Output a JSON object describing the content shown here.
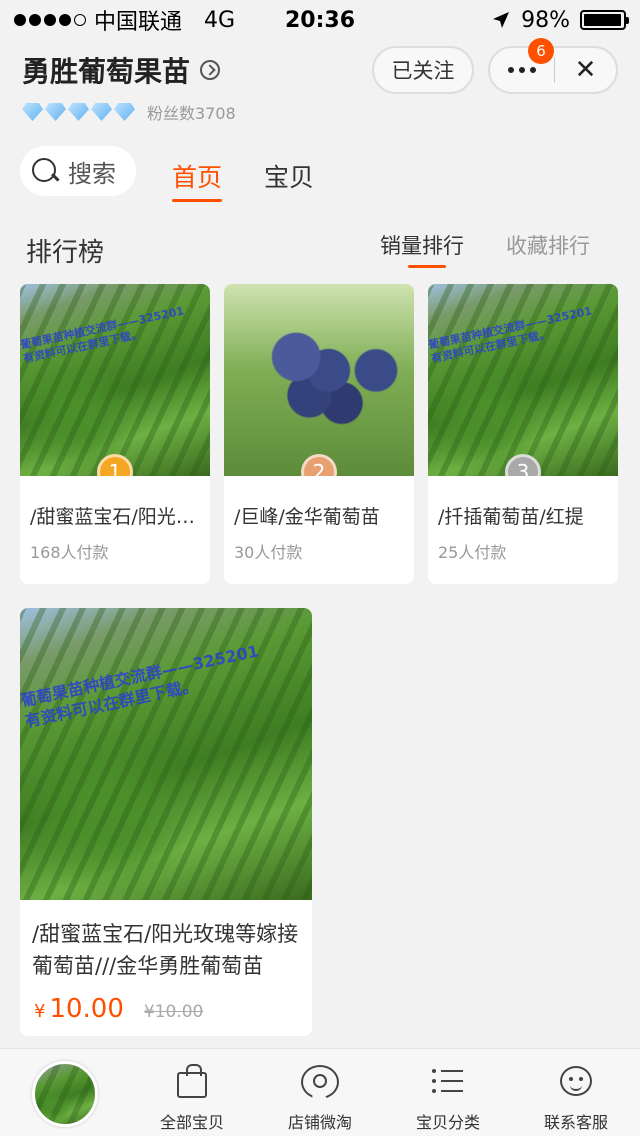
{
  "status_bar": {
    "carrier": "中国联通",
    "network": "4G",
    "time": "20:36",
    "battery": "98%",
    "battery_level": 0.98,
    "signal_dots_filled": 4,
    "signal_dots_total": 5
  },
  "shop": {
    "name": "勇胜葡萄果苗",
    "fans": "粉丝数3708",
    "diamond_count": 5,
    "follow_label": "已关注",
    "notification_count": "6"
  },
  "search": {
    "label": "搜索"
  },
  "tabs": [
    {
      "label": "首页",
      "active": true
    },
    {
      "label": "宝贝",
      "active": false
    }
  ],
  "ranking": {
    "title": "排行榜",
    "tabs": [
      {
        "label": "销量排行",
        "active": true
      },
      {
        "label": "收藏排行",
        "active": false
      }
    ],
    "items": [
      {
        "rank": "1",
        "title": "/甜蜜蓝宝石/阳光玫瑰等嫁接葡萄苗",
        "sold": "168人付款",
        "image": "grape-vine-photo"
      },
      {
        "rank": "2",
        "title": "/巨峰/金华葡萄苗",
        "sold": "30人付款",
        "image": "grape-bunch-photo"
      },
      {
        "rank": "3",
        "title": "/扦插葡萄苗/红提",
        "sold": "25人付款",
        "image": "grape-vine-photo"
      }
    ]
  },
  "watermark": {
    "line1": "葡萄果苗种植交流群——325201",
    "line2": "有资料可以在群里下载。"
  },
  "featured": {
    "title": "/甜蜜蓝宝石/阳光玫瑰等嫁接葡萄苗///金华勇胜葡萄苗",
    "currency": "¥",
    "price": "10.00",
    "original_price": "¥10.00",
    "image": "grape-vine-photo"
  },
  "bottom_nav": [
    {
      "label": "全部宝贝",
      "icon": "bag-icon"
    },
    {
      "label": "店铺微淘",
      "icon": "broadcast-icon"
    },
    {
      "label": "宝贝分类",
      "icon": "list-icon"
    },
    {
      "label": "联系客服",
      "icon": "chat-icon"
    }
  ],
  "colors": {
    "accent": "#ff5000",
    "background": "#f2f2f2",
    "watermark": "#2a3fd0"
  }
}
